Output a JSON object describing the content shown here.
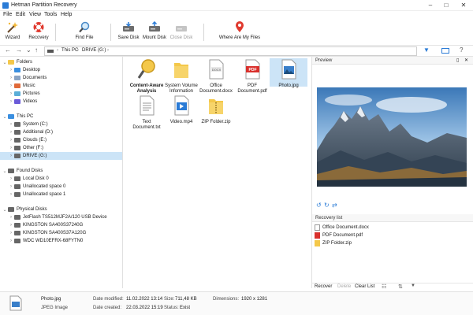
{
  "window": {
    "title": "Hetman Partition Recovery",
    "minimize": "–",
    "maximize": "□",
    "close": "✕"
  },
  "menu": [
    "File",
    "Edit",
    "View",
    "Tools",
    "Help"
  ],
  "toolbar": {
    "wizard": "Wizard",
    "recovery": "Recovery",
    "find_file": "Find File",
    "save_disk": "Save Disk",
    "mount_disk": "Mount Disk",
    "close_disk": "Close Disk",
    "where_files": "Where Are My Files"
  },
  "address": {
    "this_pc": "This PC",
    "drive": "DRIVE (G:)"
  },
  "tree": {
    "folders_label": "Folders",
    "folders": [
      "Desktop",
      "Documents",
      "Music",
      "Pictures",
      "Videos"
    ],
    "thispc_label": "This PC",
    "drives": [
      "System (C:)",
      "Additional (D:)",
      "Clouds (E:)",
      "Other (F:)",
      "DRIVE (G:)"
    ],
    "found_label": "Found Disks",
    "found": [
      "Local Disk 0",
      "Unallocated space 0",
      "Unallocated space 1"
    ],
    "physical_label": "Physical Disks",
    "physical": [
      "JetFlash TS512MJF2A/120 USB Device",
      "KINGSTON SA400S37240G",
      "KINGSTON SA400S37A120G",
      "WDC WD10EFRX-68FYTN0"
    ]
  },
  "files": [
    {
      "name": "Content-Aware Analysis",
      "type": "analysis"
    },
    {
      "name": "System Volume Information",
      "type": "folder"
    },
    {
      "name": "Office Document.docx",
      "type": "docx",
      "tag": "DOCX"
    },
    {
      "name": "PDF Document.pdf",
      "type": "pdf",
      "tag": "PDF"
    },
    {
      "name": "Photo.jpg",
      "type": "jpg"
    },
    {
      "name": "Text Document.txt",
      "type": "txt"
    },
    {
      "name": "Video.mp4",
      "type": "mp4"
    },
    {
      "name": "ZIP Folder.zip",
      "type": "zip"
    }
  ],
  "preview": {
    "title": "Preview",
    "pin": "▯",
    "close": "✕"
  },
  "recovery_list": {
    "title": "Recovery list",
    "items": [
      "Office Document.docx",
      "PDF Document.pdf",
      "ZIP Folder.zip"
    ],
    "recover": "Recover",
    "delete": "Delete",
    "clear": "Clear List"
  },
  "status": {
    "filename": "Photo.jpg",
    "filetype": "JPEG Image",
    "modified_label": "Date modified:",
    "modified": "11.02.2022 13:14",
    "created_label": "Date created:",
    "created": "22.03.2022 15:19",
    "size_label": "Size:",
    "size": "711,48 KB",
    "status_label": "Status:",
    "status": "Exist",
    "dim_label": "Dimensions:",
    "dim": "1920 x 1281"
  },
  "colors": {
    "accent": "#2a7bd6",
    "selection": "#cce4f7",
    "pdf": "#d9302c",
    "folder": "#f4c84a"
  }
}
